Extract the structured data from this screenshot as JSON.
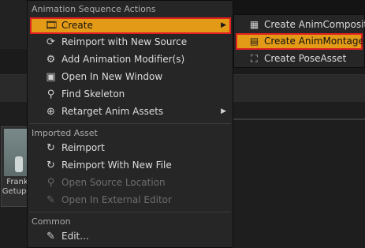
{
  "menu": {
    "sections": [
      {
        "header": "Animation Sequence Actions",
        "items": [
          {
            "label": "Create",
            "icon": "create-anim-icon",
            "glyph": "🎞",
            "has_submenu": true,
            "highlighted": true
          },
          {
            "label": "Reimport with New Source",
            "icon": "reimport-new-source-icon",
            "glyph": "⟳"
          },
          {
            "label": "Add Animation Modifier(s)",
            "icon": "animation-modifier-icon",
            "glyph": "⚙"
          },
          {
            "label": "Open In New Window",
            "icon": "open-window-icon",
            "glyph": "▣"
          },
          {
            "label": "Find Skeleton",
            "icon": "find-skeleton-icon",
            "glyph": "⚲"
          },
          {
            "label": "Retarget Anim Assets",
            "icon": "retarget-icon",
            "glyph": "⊕",
            "has_submenu": true
          }
        ]
      },
      {
        "header": "Imported Asset",
        "items": [
          {
            "label": "Reimport",
            "icon": "reimport-icon",
            "glyph": "↻"
          },
          {
            "label": "Reimport With New File",
            "icon": "reimport-new-file-icon",
            "glyph": "↻"
          },
          {
            "label": "Open Source Location",
            "icon": "source-location-icon",
            "glyph": "⚲",
            "disabled": true
          },
          {
            "label": "Open In External Editor",
            "icon": "external-editor-icon",
            "glyph": "✎",
            "disabled": true
          }
        ]
      },
      {
        "header": "Common",
        "items": [
          {
            "label": "Edit...",
            "icon": "edit-icon",
            "glyph": "✎"
          }
        ]
      }
    ]
  },
  "submenu": {
    "items": [
      {
        "label": "Create AnimComposite",
        "icon": "anim-composite-icon",
        "glyph": "▦"
      },
      {
        "label": "Create AnimMontage",
        "icon": "anim-montage-icon",
        "glyph": "▤",
        "highlighted": true
      },
      {
        "label": "Create PoseAsset",
        "icon": "pose-asset-icon",
        "glyph": "⛶"
      }
    ]
  },
  "asset": {
    "label_line1": "Frank",
    "label_line2": "GetupO"
  },
  "colors": {
    "highlight": "#e39b17",
    "highlight_border": "#e02020",
    "menu_bg": "#262626"
  }
}
